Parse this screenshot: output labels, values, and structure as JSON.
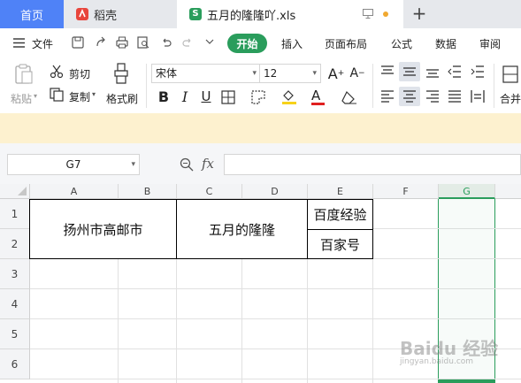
{
  "tabs": {
    "home": "首页",
    "wps": "稻壳",
    "doc": "五月的隆隆吖.xls",
    "add": "+"
  },
  "menu": {
    "file": "文件",
    "start": "开始",
    "insert": "插入",
    "layout": "页面布局",
    "formula": "公式",
    "data": "数据",
    "review": "审阅"
  },
  "ribbon": {
    "paste": "粘贴",
    "cut": "剪切",
    "copy": "复制",
    "format_painter": "格式刷",
    "font_name": "宋体",
    "font_size": "12",
    "merge": "合并"
  },
  "formula_bar": {
    "cell_ref": "G7",
    "fx": "fx",
    "content": ""
  },
  "grid": {
    "columns": [
      "A",
      "B",
      "C",
      "D",
      "E",
      "F",
      "G"
    ],
    "rows": [
      "1",
      "2",
      "3",
      "4",
      "5",
      "6"
    ],
    "active_column": "G",
    "cells": {
      "AB_1_2": "扬州市高邮市",
      "CD_1_2": "五月的隆隆",
      "E1": "百度经验",
      "E2": "百家号"
    }
  },
  "watermark": {
    "main": "Baidu 经验",
    "sub": "jingyan.baidu.com"
  },
  "colors": {
    "home_tab": "#4f82f7",
    "start_button": "#2a9d5c",
    "notice": "#fdf1cf",
    "active_col": "#2a9d5c"
  }
}
